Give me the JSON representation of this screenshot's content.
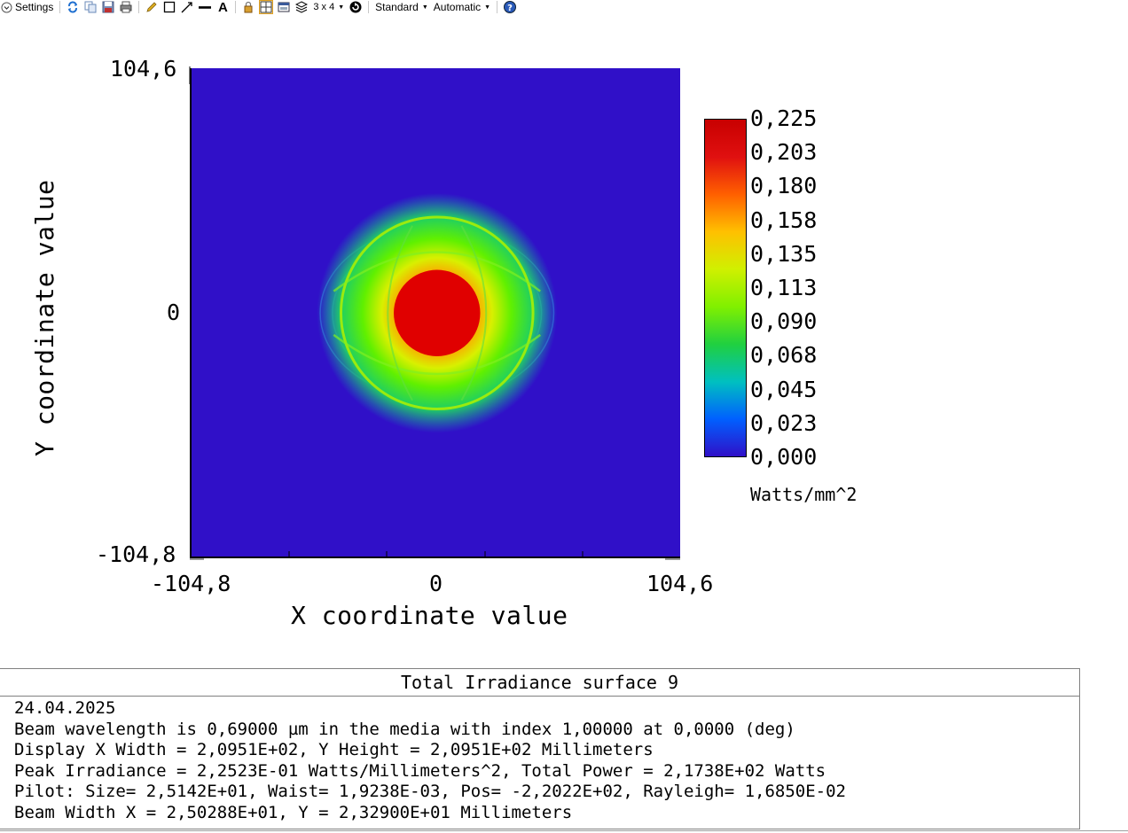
{
  "toolbar": {
    "settings_label": "Settings",
    "layout_label": "3 x 4",
    "standard_label": "Standard",
    "automatic_label": "Automatic",
    "icons": [
      "settings-chevron-icon",
      "refresh-icon",
      "copy-icon",
      "save-icon",
      "print-icon",
      "pencil-icon",
      "rectangle-icon",
      "line-arrow-icon",
      "line-icon",
      "text-icon",
      "lock-icon",
      "window-layout-icon",
      "clone-icon",
      "layers-icon",
      "layout-grid-icon",
      "rotate-icon",
      "help-icon"
    ]
  },
  "chart_data": {
    "type": "heatmap",
    "xlabel": "X coordinate value",
    "ylabel": "Y coordinate value",
    "x_ticks": [
      "-104,8",
      "0",
      "104,6"
    ],
    "y_ticks": [
      "104,6",
      "0",
      "-104,8"
    ],
    "xlim": [
      -104.8,
      104.6
    ],
    "ylim": [
      -104.8,
      104.6
    ],
    "colorbar": {
      "labels": [
        "0,225",
        "0,203",
        "0,180",
        "0,158",
        "0,135",
        "0,113",
        "0,090",
        "0,068",
        "0,045",
        "0,023",
        "0,000"
      ],
      "unit": "Watts/mm^2",
      "min": 0.0,
      "max": 0.225,
      "colors": [
        "#3010c8",
        "#0060ff",
        "#00c0c0",
        "#20d040",
        "#80f000",
        "#d0f000",
        "#ffc000",
        "#ff6000",
        "#e01010",
        "#c80000"
      ]
    },
    "spot": {
      "center_x": 0,
      "center_y": 0,
      "peak": 0.225,
      "halo_width_x": 50,
      "halo_height_y": 37,
      "ring_radius": 20
    }
  },
  "info": {
    "title": "Total Irradiance surface 9",
    "lines": [
      "24.04.2025",
      "Beam wavelength is 0,69000 µm in the media with index 1,00000 at 0,0000 (deg)",
      "Display X Width = 2,0951E+02, Y Height = 2,0951E+02 Millimeters",
      "Peak Irradiance = 2,2523E-01 Watts/Millimeters^2, Total Power = 2,1738E+02 Watts",
      "Pilot: Size= 2,5142E+01, Waist= 1,9238E-03, Pos= -2,2022E+02, Rayleigh= 1,6850E-02",
      "Beam Width X = 2,50288E+01, Y = 2,32900E+01 Millimeters"
    ]
  }
}
